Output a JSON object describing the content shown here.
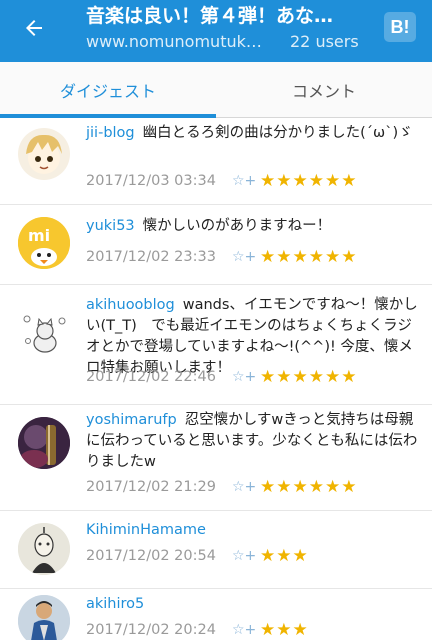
{
  "appbar": {
    "title": "音楽は良い！第４弾！あな…",
    "domain": "www.nomunomutuk…",
    "users": "22 users",
    "hatena_label": "B!"
  },
  "tabs": [
    {
      "label": "ダイジェスト",
      "active": true
    },
    {
      "label": "コメント",
      "active": false
    }
  ],
  "comments": [
    {
      "user": "jii-blog",
      "text": "幽白とるろ剣の曲は分かりました(´ω`)ゞ",
      "date": "2017/12/03 03:34",
      "add_star": "☆+",
      "stars": "★★★★★★",
      "star_count": 6
    },
    {
      "user": "yuki53",
      "text": "懐かしいのがありますねー！",
      "date": "2017/12/02 23:33",
      "add_star": "☆+",
      "stars": "★★★★★★",
      "star_count": 6
    },
    {
      "user": "akihuooblog",
      "text": "wands、イエモンですね〜！懐かしい(T_T)　でも最近イエモンのはちょくちょくラジオとかで登場していますよね〜!(^^)! 今度、懐メロ特集お願いします！",
      "date": "2017/12/02 22:46",
      "add_star": "☆+",
      "stars": "★★★★★★",
      "star_count": 6
    },
    {
      "user": "yoshimarufp",
      "text": "忍空懐かしすwきっと気持ちは母親に伝わっていると思います。少なくとも私には伝わりましたw",
      "date": "2017/12/02 21:29",
      "add_star": "☆+",
      "stars": "★★★★★★",
      "star_count": 6
    },
    {
      "user": "KihiminHamame",
      "text": "",
      "date": "2017/12/02 20:54",
      "add_star": "☆+",
      "stars": "★★★",
      "star_count": 3
    },
    {
      "user": "akihiro5",
      "text": "",
      "date": "2017/12/02 20:24",
      "add_star": "☆+",
      "stars": "★★★",
      "star_count": 3
    }
  ],
  "colors": {
    "accent": "#1f8fd9",
    "star": "#f0b400",
    "date": "#9a9a9a"
  }
}
